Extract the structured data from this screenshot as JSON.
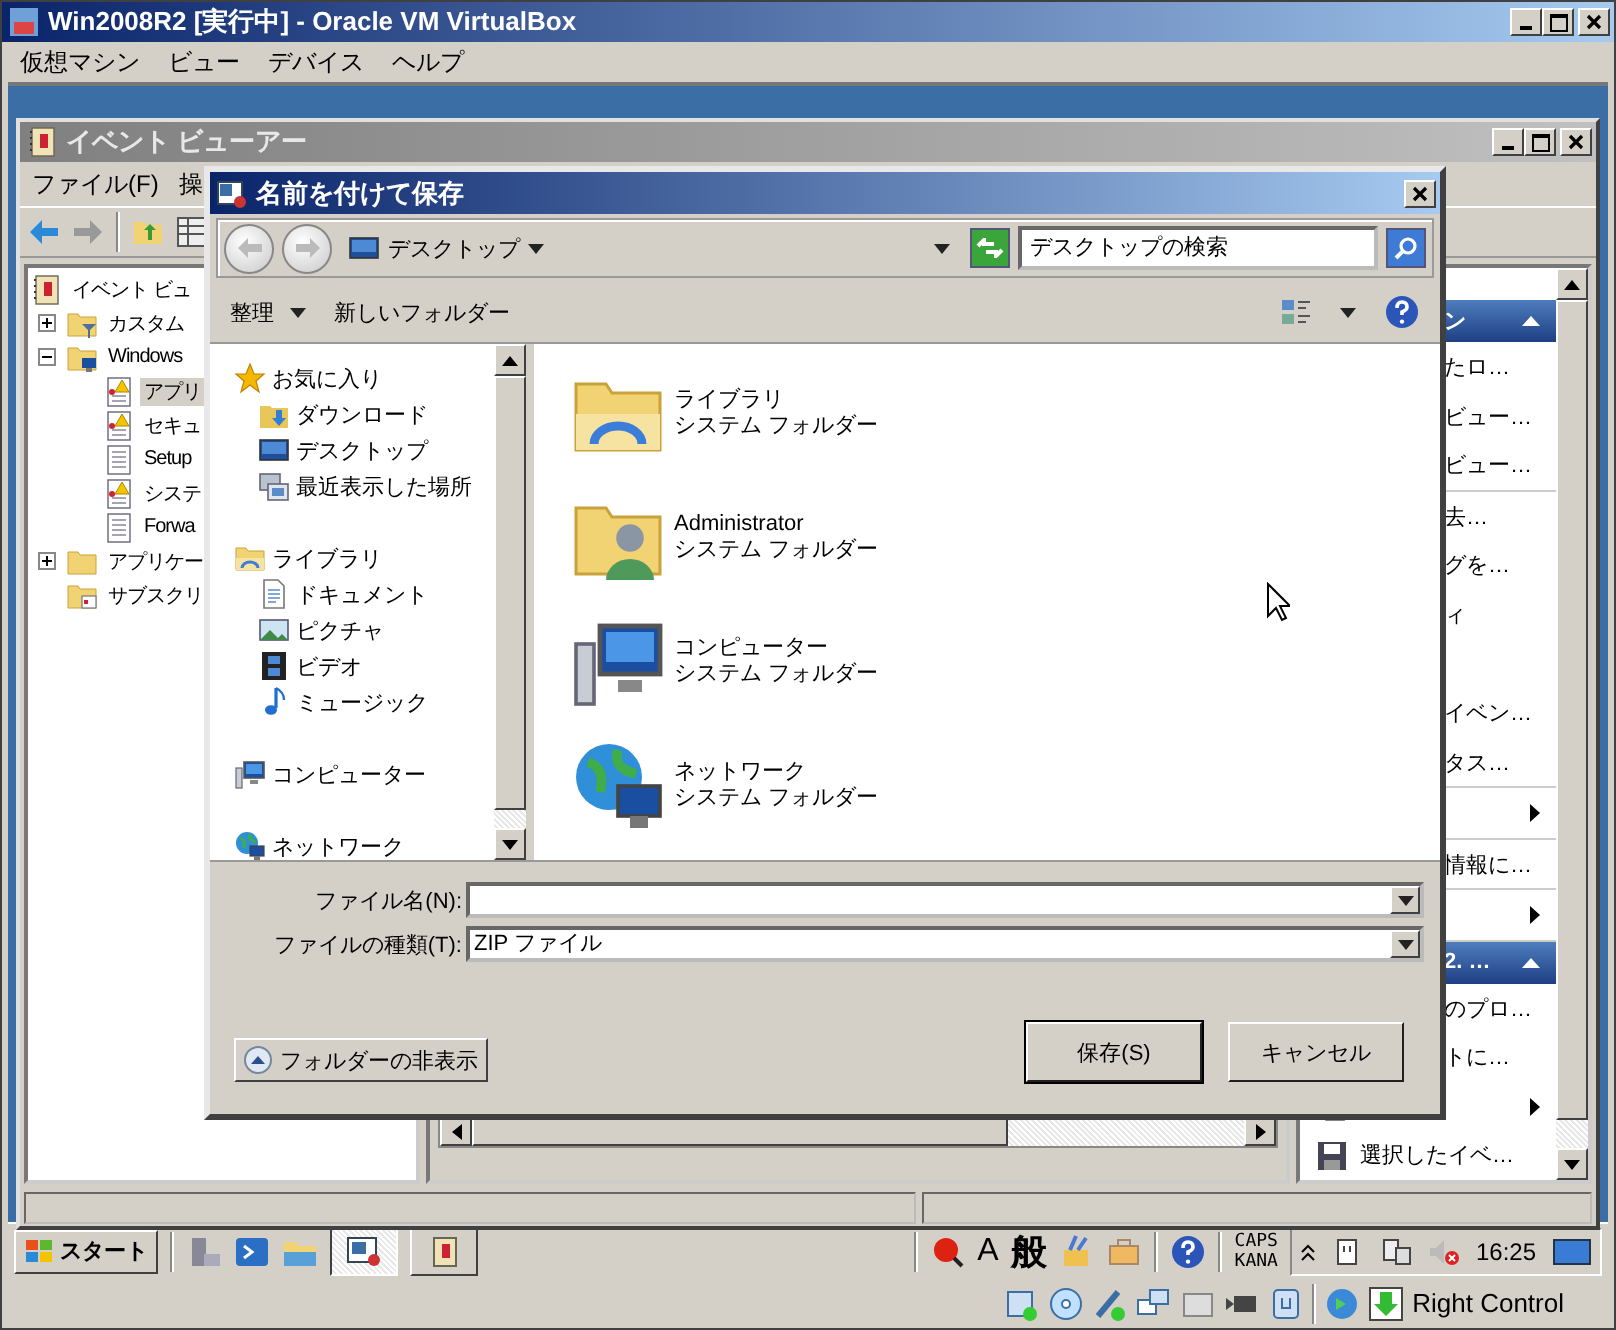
{
  "vbox": {
    "title": "Win2008R2 [実行中] - Oracle VM VirtualBox",
    "menu": [
      "仮想マシン",
      "ビュー",
      "デバイス",
      "ヘルプ"
    ],
    "host_key": "Right Control"
  },
  "event_viewer": {
    "title": "イベント ビューアー",
    "menu": [
      "ファイル(F)",
      "操"
    ],
    "tree": [
      {
        "label": "イベント ビュ",
        "kind": "viewer",
        "selected": false,
        "children": [
          {
            "label": "カスタム",
            "kind": "folder_filter",
            "expanded": false,
            "selected": false
          },
          {
            "label": "Windows",
            "kind": "folder_computer",
            "expanded": true,
            "selected": false,
            "children": [
              {
                "label": "アプリ",
                "kind": "log_warn",
                "selected": true
              },
              {
                "label": "セキュ",
                "kind": "log_warn",
                "selected": false
              },
              {
                "label": "Setup",
                "kind": "log",
                "selected": false
              },
              {
                "label": "システ",
                "kind": "log_warn",
                "selected": false
              },
              {
                "label": "Forwa",
                "kind": "log",
                "selected": false
              }
            ]
          },
          {
            "label": "アプリケー",
            "kind": "folder",
            "expanded": false,
            "selected": false
          },
          {
            "label": "サブスクリ",
            "kind": "folder_sub",
            "selected": false
          }
        ]
      }
    ],
    "actions": [
      {
        "title": "ン",
        "groups": [
          [
            {
              "label": "たロ…"
            },
            {
              "label": "ビュー…"
            },
            {
              "label": "ビュー…"
            }
          ],
          [
            {
              "label": "去…"
            },
            {
              "label": "グを…"
            },
            {
              "label": "ィ"
            },
            {
              "label": "イベン…",
              "gap_before": true
            },
            {
              "label": "タス…"
            }
          ],
          [
            {
              "submenu": true
            }
          ],
          [
            {
              "label": "情報に…"
            }
          ],
          [
            {
              "submenu": true
            }
          ]
        ]
      },
      {
        "title": "2. …",
        "groups": [
          [
            {
              "label": "のプロ…"
            },
            {
              "label": "トに…"
            },
            {
              "kind": "copy",
              "submenu": true
            },
            {
              "kind": "save",
              "label": "選択したイベ…"
            }
          ]
        ]
      }
    ]
  },
  "save_dialog": {
    "title": "名前を付けて保存",
    "location": "デスクトップ",
    "search": {
      "placeholder": "デスクトップの検索"
    },
    "toolbar": [
      {
        "label": "整理",
        "dropdown": true
      },
      {
        "label": "新しいフォルダー",
        "dropdown": false
      }
    ],
    "nav": [
      {
        "label": "お気に入り",
        "kind": "star",
        "children": [
          {
            "label": "ダウンロード",
            "kind": "download"
          },
          {
            "label": "デスクトップ",
            "kind": "desktop"
          },
          {
            "label": "最近表示した場所",
            "kind": "recent"
          }
        ]
      },
      {
        "label": "ライブラリ",
        "kind": "library",
        "children": [
          {
            "label": "ドキュメント",
            "kind": "doc"
          },
          {
            "label": "ピクチャ",
            "kind": "picture"
          },
          {
            "label": "ビデオ",
            "kind": "video"
          },
          {
            "label": "ミュージック",
            "kind": "music"
          }
        ]
      },
      {
        "label": "コンピューター",
        "kind": "computer"
      },
      {
        "label": "ネットワーク",
        "kind": "network"
      }
    ],
    "items": [
      {
        "name": "ライブラリ",
        "type": "システム フォルダー",
        "kind": "library"
      },
      {
        "name": "Administrator",
        "type": "システム フォルダー",
        "kind": "user"
      },
      {
        "name": "コンピューター",
        "type": "システム フォルダー",
        "kind": "computer"
      },
      {
        "name": "ネットワーク",
        "type": "システム フォルダー",
        "kind": "network"
      }
    ],
    "filename": {
      "label": "ファイル名(N):"
    },
    "filetype": {
      "label": "ファイルの種類(T):",
      "value": "ZIP ファイル"
    },
    "hide_folders": "フォルダーの非表示",
    "save": "保存(S)",
    "cancel": "キャンセル"
  },
  "taskbar": {
    "start": "スタート",
    "tasks": [
      {
        "selected": true
      },
      {
        "selected": false
      }
    ],
    "ime": [
      "A",
      "般"
    ],
    "caps": "CAPS",
    "kana": "KANA",
    "clock": "16:25"
  }
}
